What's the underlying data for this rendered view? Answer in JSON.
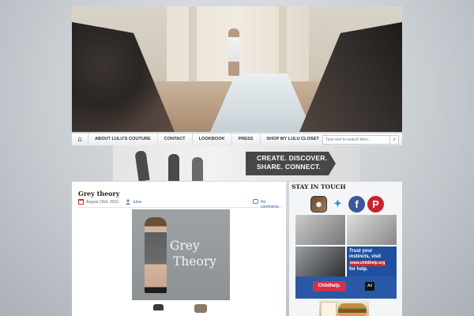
{
  "nav": {
    "home_icon": "home-icon",
    "items": [
      {
        "label": "About Lulu's Couture"
      },
      {
        "label": "Contact"
      },
      {
        "label": "Lookbook"
      },
      {
        "label": "Press"
      },
      {
        "label": "Shop My Lulu Closet"
      }
    ],
    "search": {
      "placeholder": "Type text to search here...",
      "icon": "search-icon"
    }
  },
  "banner": {
    "line1": "CREATE. DISCOVER.",
    "line2": "SHARE. CONNECT."
  },
  "post": {
    "title": "Grey theory",
    "date": "August 23rd, 2016",
    "author": "lulus",
    "comments": "No comments",
    "image_text_line1": "Grey",
    "image_text_line2": "Theory"
  },
  "sidebar": {
    "heading": "STAY IN TOUCH",
    "social": [
      {
        "name": "instagram",
        "icon": "instagram-icon"
      },
      {
        "name": "twitter",
        "icon": "twitter-icon"
      },
      {
        "name": "facebook",
        "icon": "facebook-icon"
      },
      {
        "name": "pinterest",
        "icon": "pinterest-icon"
      }
    ],
    "ad": {
      "line1": "Trust your",
      "line2": "instincts, visit",
      "url": "www.childhelp.org",
      "line3": "for help.",
      "logo": "Childhelp.",
      "badge": "Ad"
    }
  },
  "colors": {
    "facebook": "#3b5998",
    "pinterest": "#c8232c",
    "twitter": "#3a95d6",
    "link": "#3a62a8",
    "ad_blue": "#1f4fa0"
  }
}
